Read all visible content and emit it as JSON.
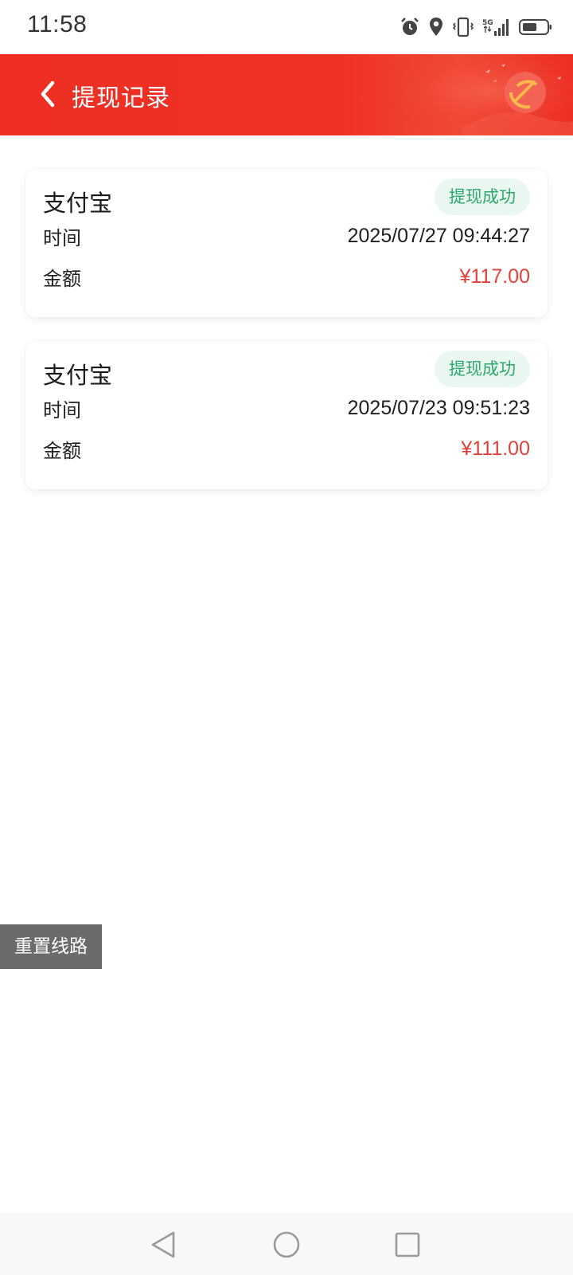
{
  "status_bar": {
    "time": "11:58",
    "network": "5G",
    "icons": [
      "alarm-icon",
      "location-icon",
      "vibrate-icon",
      "signal-icon",
      "battery-icon"
    ]
  },
  "header": {
    "title": "提现记录",
    "back_icon": "chevron-left-icon",
    "background_color": "#ee2e22"
  },
  "records": [
    {
      "method": "支付宝",
      "status": "提现成功",
      "time_label": "时间",
      "time_value": "2025/07/27 09:44:27",
      "amount_label": "金额",
      "amount_value": "¥117.00"
    },
    {
      "method": "支付宝",
      "status": "提现成功",
      "time_label": "时间",
      "time_value": "2025/07/23 09:51:23",
      "amount_label": "金额",
      "amount_value": "¥111.00"
    }
  ],
  "floating": {
    "reset_label": "重置线路"
  },
  "nav_bar": {
    "icons": [
      "back-triangle-icon",
      "home-circle-icon",
      "recents-square-icon"
    ]
  },
  "colors": {
    "accent_red": "#ee2e22",
    "amount_red": "#e0413a",
    "success_green": "#2da86b",
    "success_bg": "#e9f7f0"
  }
}
